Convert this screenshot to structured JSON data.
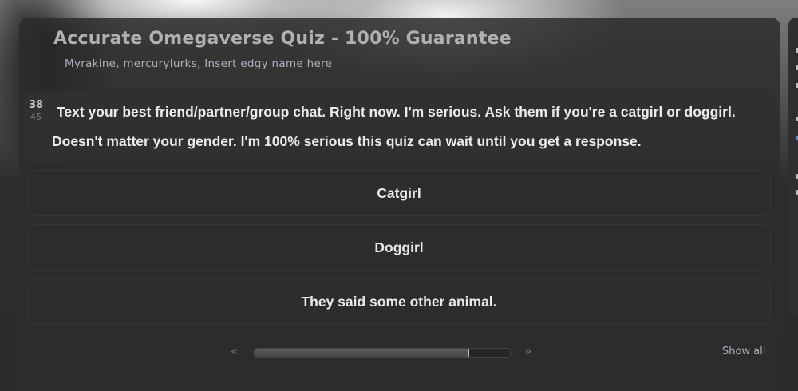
{
  "quiz": {
    "title": "Accurate Omegaverse Quiz - 100% Guarantee",
    "authors": "Myrakine, mercurylurks, Insert edgy name here"
  },
  "question": {
    "current": "38",
    "total": "45",
    "text": "Text your best friend/partner/group chat. Right now. I'm serious. Ask them if you're a catgirl or doggirl. Doesn't matter your gender. I'm 100% serious this quiz can wait until you get a response."
  },
  "answers": [
    {
      "label": "Catgirl"
    },
    {
      "label": "Doggirl"
    },
    {
      "label": "They said some other animal."
    }
  ],
  "pager": {
    "prev_icon": "«",
    "next_icon": "»",
    "progress": 0.84,
    "show_all_label": "Show all"
  },
  "colors": {
    "panel_bg": "#2c2c2c",
    "title": "#b0b0b0",
    "authors": "#a9b0bf",
    "question_text": "#ececec",
    "link": "#a9b0bf"
  }
}
